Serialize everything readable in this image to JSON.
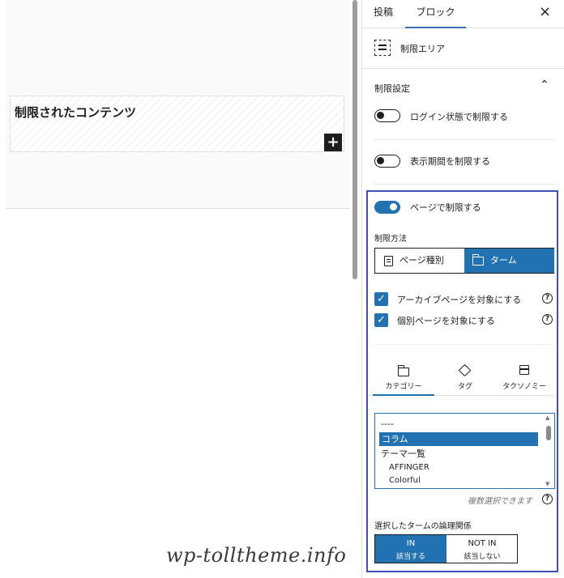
{
  "editor": {
    "block_title": "制限されたコンテンツ",
    "add_block": "+"
  },
  "watermark": "wp-tolltheme.info",
  "sidebar": {
    "tabs": {
      "post": "投稿",
      "block": "ブロック",
      "close": "×"
    },
    "block_name": "制限エリア",
    "section_title": "制限設定",
    "toggles": [
      {
        "label": "ログイン状態で制限する",
        "on": false
      },
      {
        "label": "表示期間を制限する",
        "on": false
      },
      {
        "label": "ページで制限する",
        "on": true
      }
    ],
    "method_label": "制限方法",
    "method_options": {
      "page_type": "ページ種別",
      "term": "ターム"
    },
    "checkboxes": [
      {
        "label": "アーカイブページを対象にする",
        "checked": true
      },
      {
        "label": "個別ページを対象にする",
        "checked": true
      }
    ],
    "taxonomy_tabs": {
      "category": "カテゴリー",
      "tag": "タグ",
      "taxonomy": "タクソノミー"
    },
    "term_list": [
      "----",
      "コラム",
      "テーマ一覧",
      "AFFINGER",
      "Colorful"
    ],
    "selected_term": "コラム",
    "multi_select_hint": "複数選択できます",
    "logic_label": "選択したタームの論理関係",
    "logic_in": {
      "main": "IN",
      "sub": "該当する"
    },
    "logic_not_in": {
      "main": "NOT IN",
      "sub": "該当しない"
    }
  },
  "colors": {
    "accent": "#2271b1",
    "highlight_border": "#3f51b5"
  }
}
